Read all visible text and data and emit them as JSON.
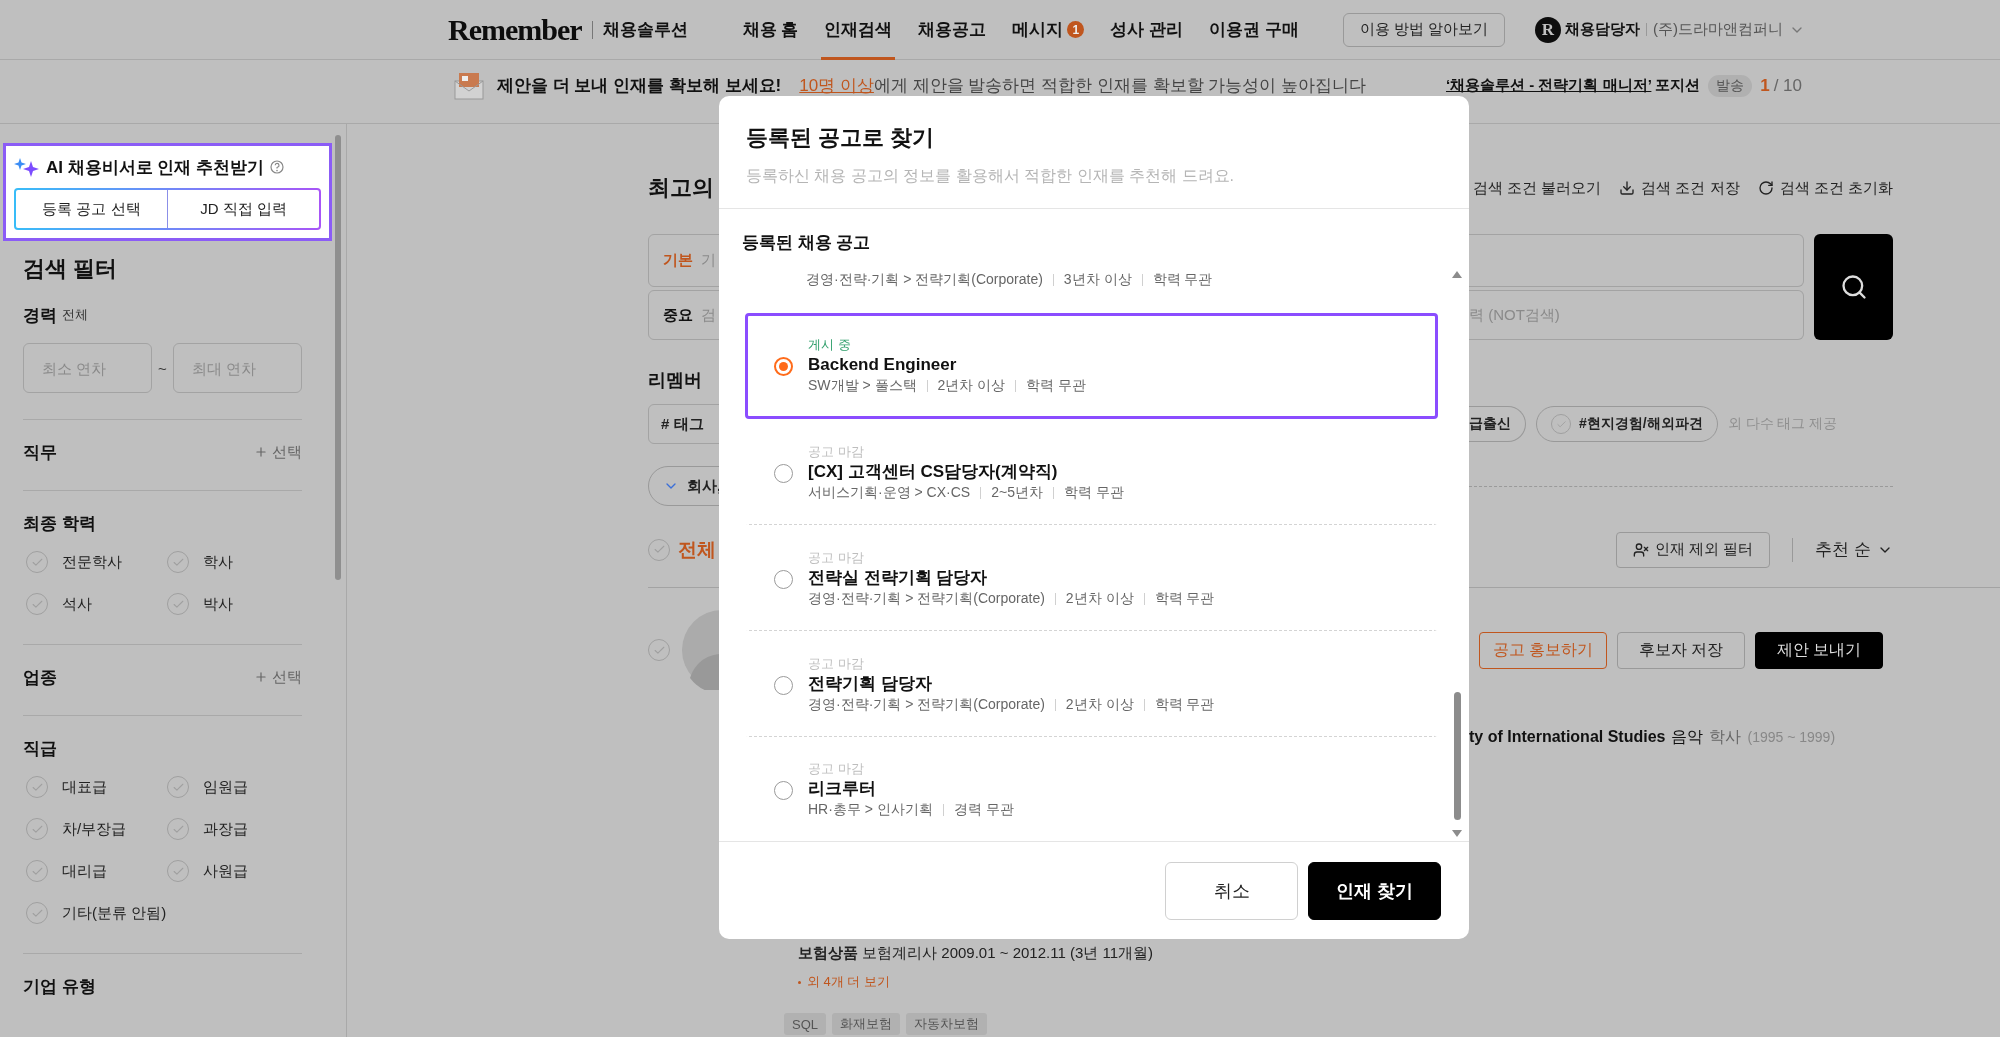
{
  "header": {
    "logo": "Remember",
    "product": "채용솔루션",
    "nav": [
      {
        "label": "채용 홈",
        "selected": false
      },
      {
        "label": "인재검색",
        "selected": true
      },
      {
        "label": "채용공고",
        "selected": false
      },
      {
        "label": "메시지",
        "selected": false,
        "badge": "1"
      },
      {
        "label": "성사 관리",
        "selected": false
      },
      {
        "label": "이용권 구매",
        "selected": false
      }
    ],
    "help_button": "이용 방법 알아보기",
    "avatar_letter": "R",
    "user": "채용담당자",
    "company": "(주)드라마앤컴퍼니"
  },
  "banner": {
    "headline": "제안을 더 보내 인재를 확보해 보세요!",
    "highlight": "10명 이상",
    "message": "에게 제안을 발송하면 적합한 인재를 확보할 가능성이 높아집니다",
    "position_link": "‘채용솔루션 - 전략기획 매니저’",
    "position_suffix": "포지션",
    "sent_label": "발송",
    "sent_count": "1",
    "sent_total": "/ 10"
  },
  "sidebar": {
    "ai_box": {
      "title": "AI 채용비서로 인재 추천받기",
      "buttons": [
        "등록 공고 선택",
        "JD 직접 입력"
      ]
    },
    "title": "검색 필터",
    "sections": [
      {
        "kind": "range",
        "title": "경력",
        "note": "전체",
        "min_placeholder": "최소 연차",
        "separator": "~",
        "max_placeholder": "최대 연차"
      },
      {
        "kind": "picker",
        "title": "직무",
        "action": "선택"
      },
      {
        "kind": "checks",
        "title": "최종 학력",
        "options": [
          {
            "label": "전문학사",
            "checked": false
          },
          {
            "label": "학사",
            "checked": false
          },
          {
            "label": "석사",
            "checked": false
          },
          {
            "label": "박사",
            "checked": false
          }
        ]
      },
      {
        "kind": "picker",
        "title": "업종",
        "action": "선택"
      },
      {
        "kind": "checks",
        "title": "직급",
        "options": [
          {
            "label": "대표급",
            "checked": false
          },
          {
            "label": "임원급",
            "checked": false
          },
          {
            "label": "차/부장급",
            "checked": false
          },
          {
            "label": "과장급",
            "checked": false
          },
          {
            "label": "대리급",
            "checked": false
          },
          {
            "label": "사원급",
            "checked": false
          },
          {
            "label": "기타(분류 안됨)",
            "checked": false
          }
        ]
      },
      {
        "kind": "heading",
        "title": "기업 유형"
      }
    ]
  },
  "main": {
    "title": "최고의",
    "toolbar": [
      "검색 조건 불러오기",
      "검색 조건 저장",
      "검색 조건 초기화"
    ],
    "search_fields": [
      {
        "label": "기본",
        "placeholder": "기"
      },
      {
        "label": "중요",
        "placeholder": "검"
      }
    ],
    "exclude_placeholder": "력 (NOT검색)",
    "tags_heading": "리멤버",
    "tag_input": "# 태그",
    "tags": [
      {
        "label": "급출신"
      },
      {
        "label": "#현지경험/해외파견",
        "checked": false
      }
    ],
    "tags_more": "외 다수 태그 제공",
    "filter_chip": "회사,",
    "select_all": {
      "label": "전체",
      "checked": false
    },
    "exclude_filter": "인재 제외 필터",
    "sort": "추천 순",
    "candidate": {
      "checked": false,
      "actions": [
        "공고 홍보하기",
        "후보자 저장",
        "제안 보내기"
      ],
      "school": "ty of International Studies",
      "major": "음악",
      "degree": "학사",
      "period": "(1995 ~ 1999)",
      "career": "**보험상품** 보험계리사 2009.01 ~ 2012.11 (3년 11개월)",
      "more": "외 4개 더 보기",
      "skills": [
        "SQL",
        "화재보험",
        "자동차보험"
      ]
    }
  },
  "modal": {
    "title": "등록된 공고로 찾기",
    "subtitle": "등록하신 채용 공고의 정보를 활용해서 적합한 인재를 추천해 드려요.",
    "list_title": "등록된 채용 공고",
    "jobs": [
      {
        "meta": [
          "경영·전략·기획 > 전략기획(Corporate)",
          "3년차 이상",
          "학력 무관"
        ]
      },
      {
        "posted": true,
        "status": "게시 중",
        "title": "Backend Engineer",
        "meta": [
          "SW개발 > 풀스택",
          "2년차 이상",
          "학력 무관"
        ],
        "selected": true
      },
      {
        "posted": false,
        "status": "공고 마감",
        "title": "[CX] 고객센터 CS담당자(계약직)",
        "meta": [
          "서비스기획·운영 > CX·CS",
          "2~5년차",
          "학력 무관"
        ],
        "selected": false
      },
      {
        "posted": false,
        "status": "공고 마감",
        "title": "전략실 전략기획 담당자",
        "meta": [
          "경영·전략·기획 > 전략기획(Corporate)",
          "2년차 이상",
          "학력 무관"
        ],
        "selected": false
      },
      {
        "posted": false,
        "status": "공고 마감",
        "title": "전략기획 담당자",
        "meta": [
          "경영·전략·기획 > 전략기획(Corporate)",
          "2년차 이상",
          "학력 무관"
        ],
        "selected": false
      },
      {
        "posted": false,
        "status": "공고 마감",
        "title": "리크루터",
        "meta": [
          "HR·총무 > 인사기획",
          "경력 무관"
        ],
        "selected": false
      }
    ],
    "buttons": [
      "취소",
      "인재 찾기"
    ]
  }
}
